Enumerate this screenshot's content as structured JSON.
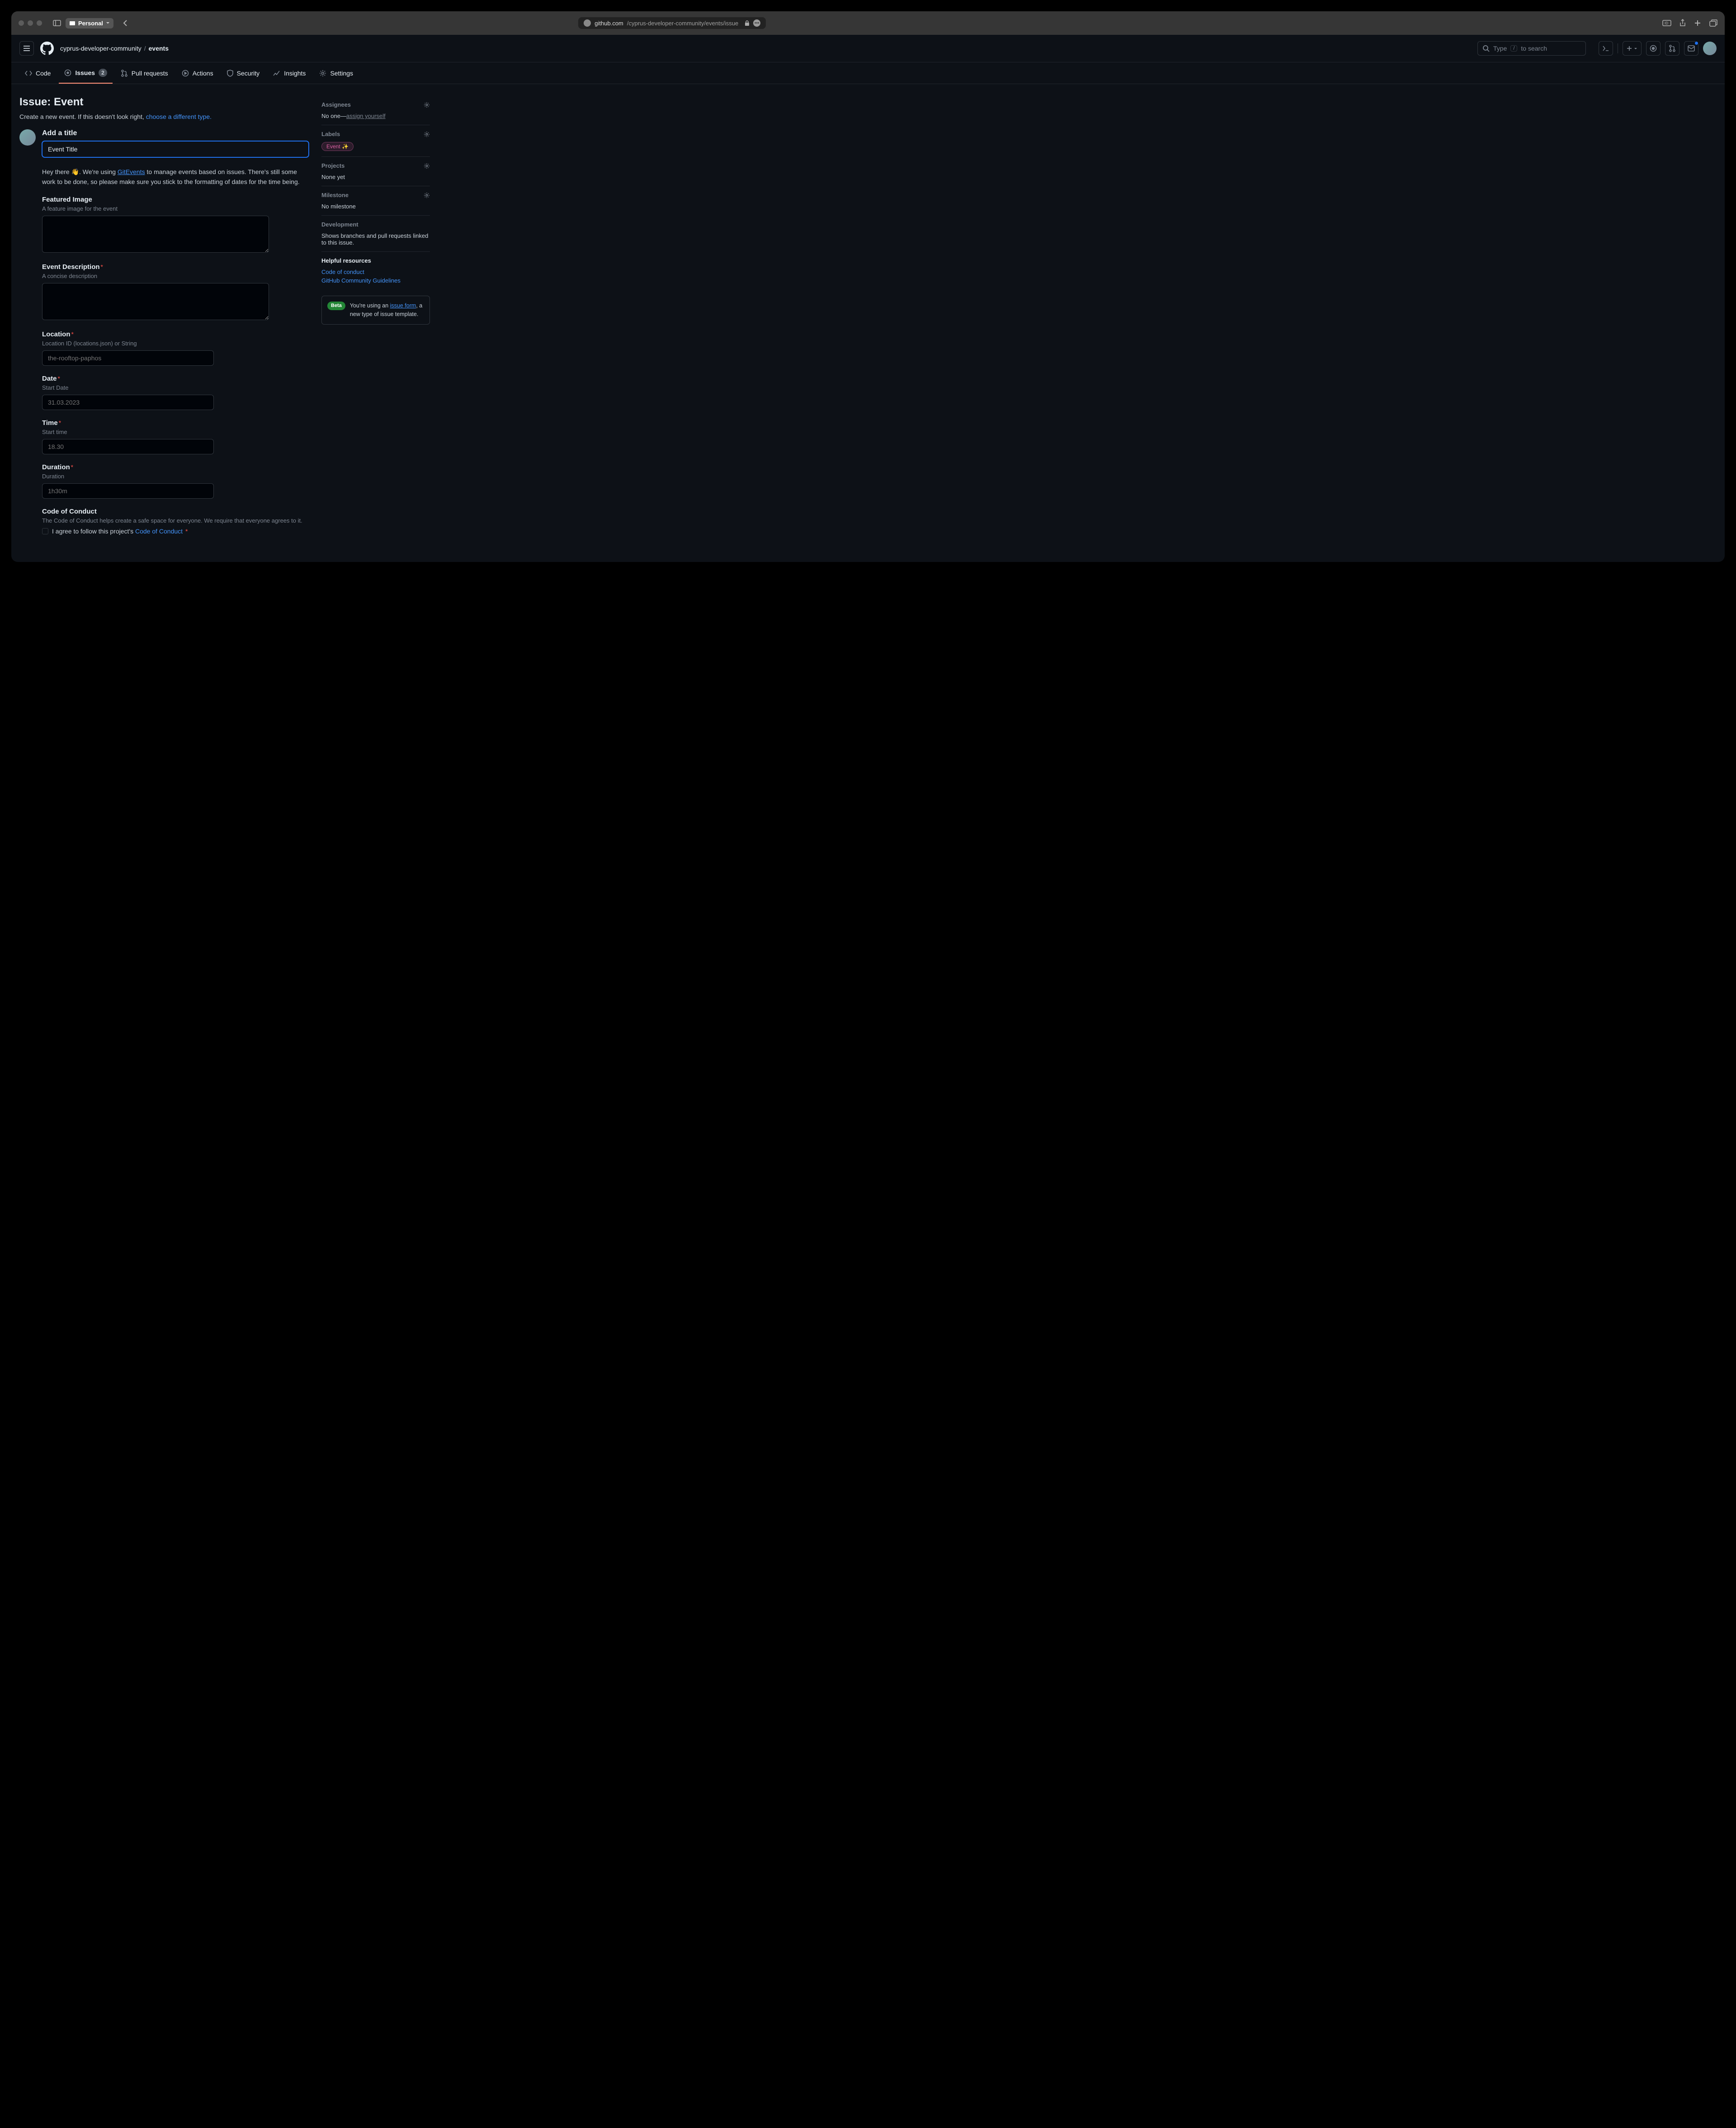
{
  "browser": {
    "profile": "Personal",
    "url_host": "github.com",
    "url_path": "/cyprus-developer-community/events/issue"
  },
  "ghTop": {
    "org": "cyprus-developer-community",
    "repo": "events",
    "search_prefix": "Type",
    "search_key": "/",
    "search_suffix": "to search"
  },
  "tabs": {
    "code": "Code",
    "issues": "Issues",
    "issues_count": "2",
    "pulls": "Pull requests",
    "actions": "Actions",
    "security": "Security",
    "insights": "Insights",
    "settings": "Settings"
  },
  "page": {
    "title": "Issue: Event",
    "subline_prefix": "Create a new event. If this doesn't look right, ",
    "subline_link": "choose a different type.",
    "add_title_label": "Add a title",
    "title_value": "Event Title",
    "intro_prefix": "Hey there 👋. We're using ",
    "intro_link": "GitEvents",
    "intro_suffix": " to manage events based on issues. There's still some work to be done, so please make sure you stick to the formatting of dates for the time being."
  },
  "fields": {
    "featured": {
      "label": "Featured Image",
      "help": "A feature image for the event"
    },
    "desc": {
      "label": "Event Description",
      "help": "A concise description"
    },
    "location": {
      "label": "Location",
      "help": "Location ID (locations.json) or String",
      "placeholder": "the-rooftop-paphos"
    },
    "date": {
      "label": "Date",
      "help": "Start Date",
      "placeholder": "31.03.2023"
    },
    "time": {
      "label": "Time",
      "help": "Start time",
      "placeholder": "18.30"
    },
    "duration": {
      "label": "Duration",
      "help": "Duration",
      "placeholder": "1h30m"
    },
    "coc": {
      "label": "Code of Conduct",
      "help": "The Code of Conduct helps create a safe space for everyone. We require that everyone agrees to it.",
      "agree_prefix": "I agree to follow this project's ",
      "agree_link": "Code of Conduct"
    }
  },
  "sidebar": {
    "assignees": {
      "title": "Assignees",
      "noone": "No one—",
      "assign": "assign yourself"
    },
    "labels": {
      "title": "Labels",
      "event": "Event ✨"
    },
    "projects": {
      "title": "Projects",
      "none": "None yet"
    },
    "milestone": {
      "title": "Milestone",
      "none": "No milestone"
    },
    "dev": {
      "title": "Development",
      "text": "Shows branches and pull requests linked to this issue."
    },
    "resources": {
      "title": "Helpful resources",
      "coc": "Code of conduct",
      "gcg": "GitHub Community Guidelines"
    },
    "beta": {
      "badge": "Beta",
      "prefix": "You're using an ",
      "link": "issue form",
      "suffix": ", a new type of issue template."
    }
  }
}
